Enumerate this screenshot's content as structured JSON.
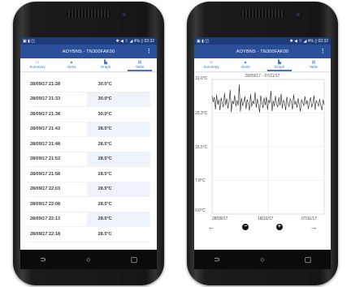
{
  "status_bar": {
    "left_icons": "▣ ▮ ◫",
    "right_text": "✱ ◀ ⌔ ◢ 4% ▯ 02:32"
  },
  "app": {
    "title": "AOYBNS - TN300FAK00"
  },
  "tabs": [
    {
      "label": "Summary",
      "icon": "summary-icon",
      "glyph": "▭"
    },
    {
      "label": "Alerts",
      "icon": "alerts-icon",
      "glyph": "▲"
    },
    {
      "label": "Graph",
      "icon": "graph-icon",
      "glyph": "▙"
    },
    {
      "label": "Table",
      "icon": "table-icon",
      "glyph": "▤"
    }
  ],
  "left_active_tab": "Table",
  "right_active_tab": "Graph",
  "table": {
    "rows": [
      {
        "time": "28/09/17 21:28",
        "temp": "30.0°C"
      },
      {
        "time": "28/09/17 21:33",
        "temp": "30.0°C"
      },
      {
        "time": "28/09/17 21:38",
        "temp": "30.0°C"
      },
      {
        "time": "28/09/17 21:43",
        "temp": "28.5°C"
      },
      {
        "time": "28/09/17 21:48",
        "temp": "28.5°C"
      },
      {
        "time": "28/09/17 21:53",
        "temp": "28.5°C"
      },
      {
        "time": "28/09/17 21:58",
        "temp": "28.5°C"
      },
      {
        "time": "28/09/17 22:03",
        "temp": "28.5°C"
      },
      {
        "time": "28/09/17 22:08",
        "temp": "28.5°C"
      },
      {
        "time": "28/09/17 22:13",
        "temp": "28.5°C"
      },
      {
        "time": "28/09/17 22:18",
        "temp": "28.5°C"
      }
    ]
  },
  "chart_data": {
    "type": "line",
    "title": "28/09/17 - 07/11/17",
    "ylim": [
      0,
      31
    ],
    "y_ticks": [
      "31.0°C",
      "23.3°C",
      "15.5°C",
      "7.8°C",
      "0.0°C"
    ],
    "y_tick_values": [
      31.0,
      23.3,
      15.5,
      7.8,
      0.0
    ],
    "x_ticks": [
      "28/09/17",
      "18/10/17",
      "07/11/17"
    ],
    "x_start": "28/09/17",
    "x_end": "07/11/17",
    "series": [
      {
        "values": [
          27.2,
          25.8,
          26.9,
          24.1,
          27.5,
          25.2,
          26.3,
          23.9,
          26.8,
          25.5,
          24.6,
          27.9,
          25.1,
          26.6,
          24.3,
          25.9,
          28.6,
          23.5,
          26.1,
          25.3,
          27.4,
          24.8,
          26.2,
          25.0,
          29.8,
          23.6,
          26.7,
          24.9,
          25.8,
          27.1,
          24.2,
          26.4,
          25.6,
          23.8,
          27.6,
          24.7,
          26.0,
          25.4,
          28.1,
          24.5,
          26.5,
          25.2,
          23.4,
          27.3,
          25.7,
          24.4,
          26.8,
          25.1,
          27.0,
          24.0,
          26.3,
          25.5,
          28.4,
          23.7,
          26.1,
          24.8,
          27.2,
          25.3,
          24.6,
          26.9,
          25.0,
          27.7,
          24.3,
          26.2,
          25.8,
          23.9,
          27.0,
          25.4,
          24.7,
          26.6,
          25.9,
          24.1,
          27.5,
          25.2,
          26.0,
          24.5,
          26.7,
          25.1,
          23.6,
          26.4,
          25.7,
          24.9,
          27.1,
          25.3,
          26.2,
          24.2,
          25.8,
          26.9,
          24.6,
          25.5,
          27.3,
          24.0,
          26.1,
          25.6,
          24.8,
          26.5,
          25.0,
          23.9,
          26.3,
          25.2
        ]
      }
    ]
  },
  "graph_controls": {
    "prev": "←",
    "zoom_out": "−",
    "zoom_in": "+",
    "next": "→"
  },
  "nav": {
    "back": "⊃",
    "home": "○",
    "recents": "▢"
  }
}
